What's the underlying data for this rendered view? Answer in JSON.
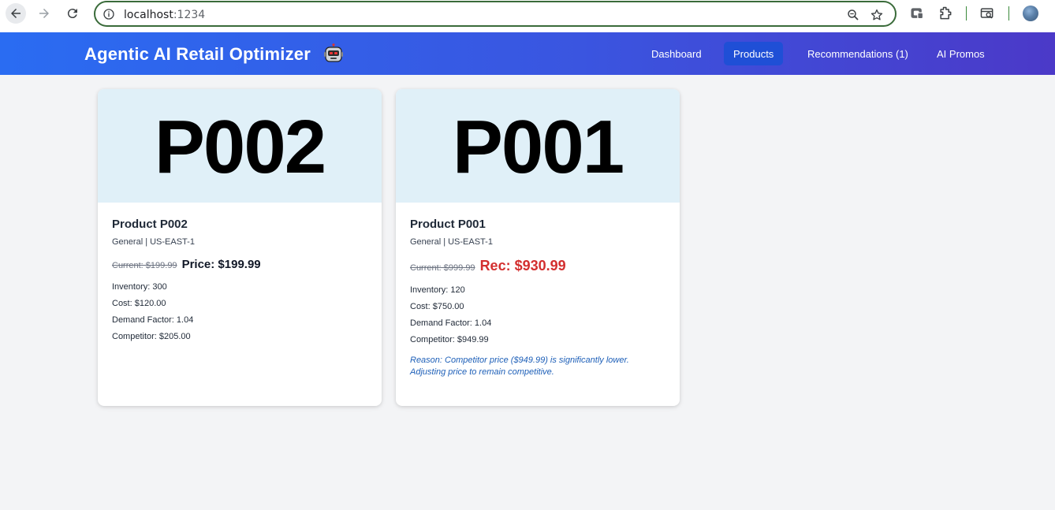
{
  "browser": {
    "url_host": "localhost",
    "url_port": ":1234"
  },
  "header": {
    "brand": "Agentic AI Retail Optimizer",
    "nav": [
      {
        "label": "Dashboard",
        "active": false
      },
      {
        "label": "Products",
        "active": true
      },
      {
        "label": "Recommendations (1)",
        "active": false
      },
      {
        "label": "AI Promos",
        "active": false
      }
    ]
  },
  "products": [
    {
      "hero_id": "P002",
      "title": "Product P002",
      "meta": "General | US-EAST-1",
      "current": "Current: $199.99",
      "price_label": "Price: $199.99",
      "inventory": "Inventory: 300",
      "cost": "Cost: $120.00",
      "demand": "Demand Factor: 1.04",
      "competitor": "Competitor: $205.00"
    },
    {
      "hero_id": "P001",
      "title": "Product P001",
      "meta": "General | US-EAST-1",
      "current": "Current: $999.99",
      "rec_label": "Rec: $930.99",
      "inventory": "Inventory: 120",
      "cost": "Cost: $750.00",
      "demand": "Demand Factor: 1.04",
      "competitor": "Competitor: $949.99",
      "reason": "Reason: Competitor price ($949.99) is significantly lower. Adjusting price to remain competitive."
    }
  ],
  "colors": {
    "header_start": "#2a6cf2",
    "header_end": "#4b39c8",
    "hero_bg": "#e0f0f8",
    "rec_price": "#d32f2f",
    "reason_text": "#1d5fb8"
  },
  "icons": {
    "back": "arrow-left-icon",
    "forward": "arrow-right-icon",
    "reload": "reload-icon",
    "info": "info-icon",
    "zoom": "zoom-icon",
    "star": "star-icon",
    "robot": "robot-icon"
  }
}
